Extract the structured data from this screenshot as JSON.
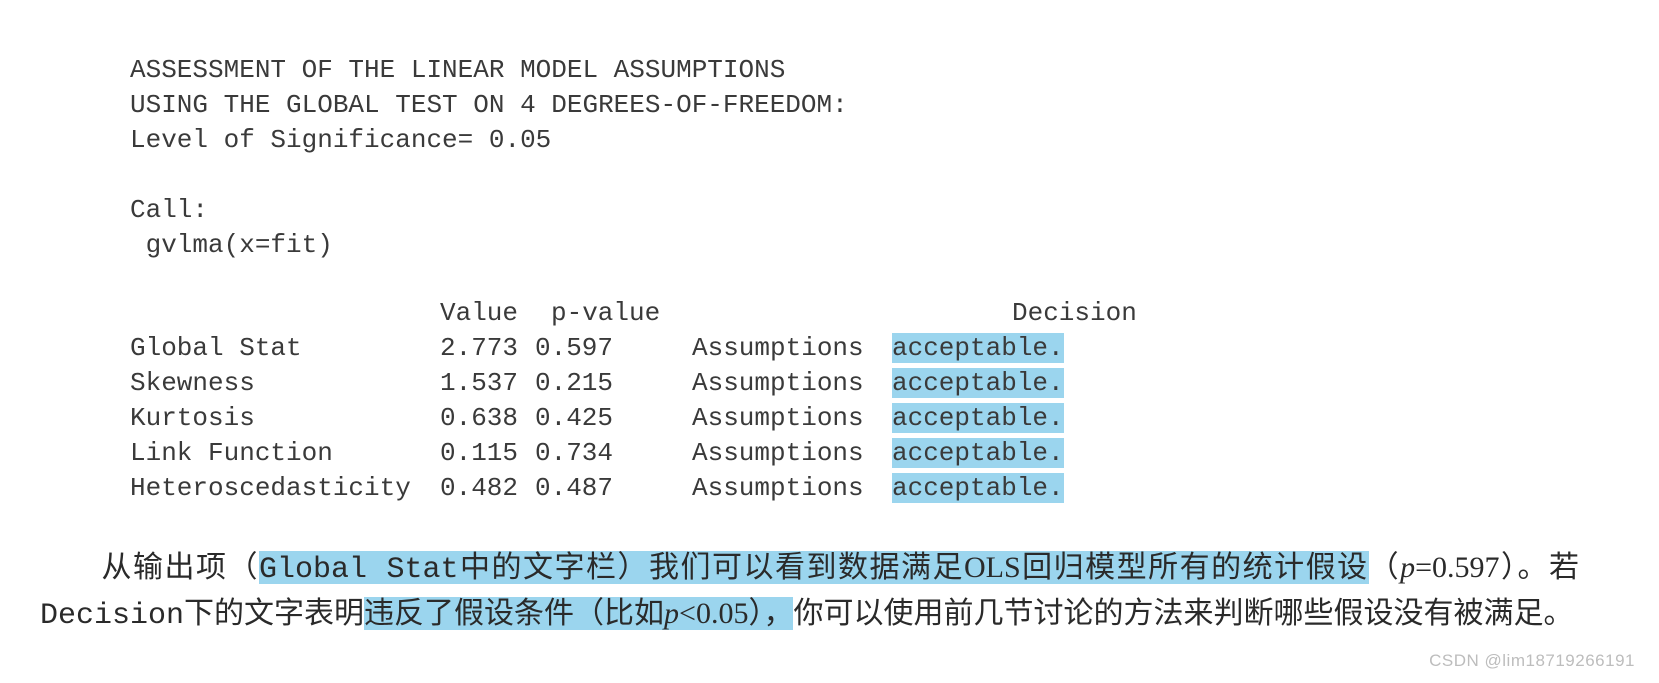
{
  "header": {
    "line1": "ASSESSMENT OF THE LINEAR MODEL ASSUMPTIONS",
    "line2": "USING THE GLOBAL TEST ON 4 DEGREES-OF-FREEDOM:",
    "line3": "Level of Significance= 0.05"
  },
  "call": {
    "label": "Call:",
    "expr": " gvlma(x=fit)"
  },
  "table": {
    "headers": {
      "value": "Value",
      "pvalue": "p-value",
      "decision": "Decision"
    },
    "assumptions_word": "Assumptions",
    "rows": [
      {
        "name": "Global Stat",
        "value": "2.773",
        "pvalue": "0.597",
        "decision": "acceptable."
      },
      {
        "name": "Skewness",
        "value": "1.537",
        "pvalue": "0.215",
        "decision": "acceptable."
      },
      {
        "name": "Kurtosis",
        "value": "0.638",
        "pvalue": "0.425",
        "decision": "acceptable."
      },
      {
        "name": "Link Function",
        "value": "0.115",
        "pvalue": "0.734",
        "decision": "acceptable."
      },
      {
        "name": "Heteroscedasticity",
        "value": "0.482",
        "pvalue": "0.487",
        "decision": "acceptable."
      }
    ]
  },
  "paragraph": {
    "t1": "从输出项（",
    "t2": "Global Stat",
    "t3": "中的文字栏）我们可以看到数据满足OLS回归模型所有的统计假设",
    "t4": "（",
    "t5": "p",
    "t6": "=0.597）。若",
    "t7": "Decision",
    "t8": "下的文字表明",
    "t9": "违反了假设条件（比如",
    "t10": "p",
    "t11": "<0.05），",
    "t12": "你可以使用前几节讨论的方法来判断哪些假设没有被满足。"
  },
  "watermark": "CSDN @lim18719266191"
}
